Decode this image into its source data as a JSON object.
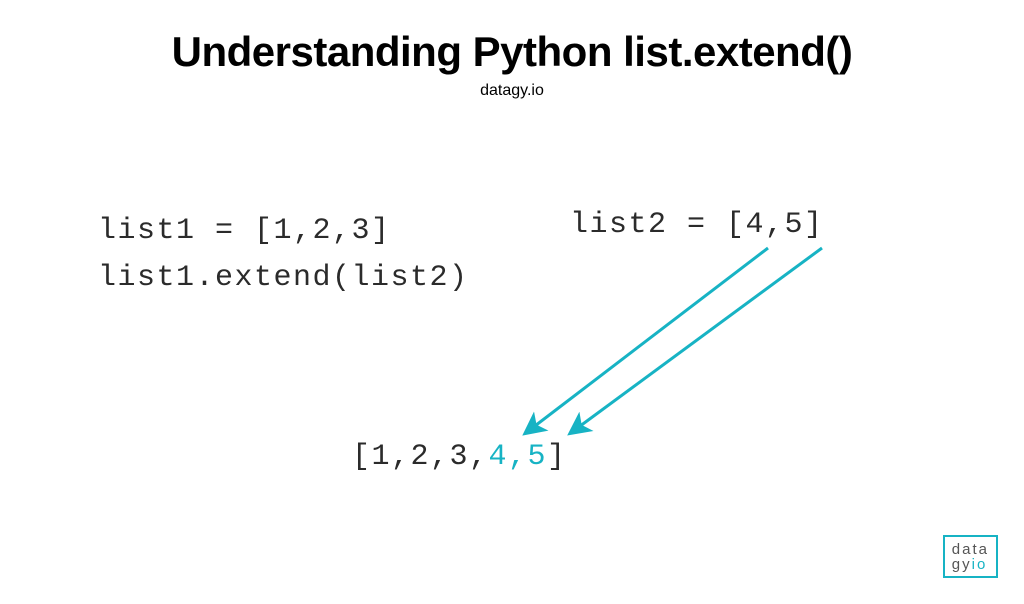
{
  "header": {
    "title": "Understanding Python list.extend()",
    "subtitle": "datagy.io"
  },
  "code": {
    "line1": "list1 = [1,2,3]",
    "line2": "list2 = [4,5]",
    "line3": "list1.extend(list2)"
  },
  "result": {
    "prefix": "[1,2,3,",
    "highlighted": "4,5",
    "suffix": "]"
  },
  "logo": {
    "row1": "data",
    "row2a": "gy",
    "row2b": "io"
  },
  "colors": {
    "accent": "#17b3c4"
  }
}
